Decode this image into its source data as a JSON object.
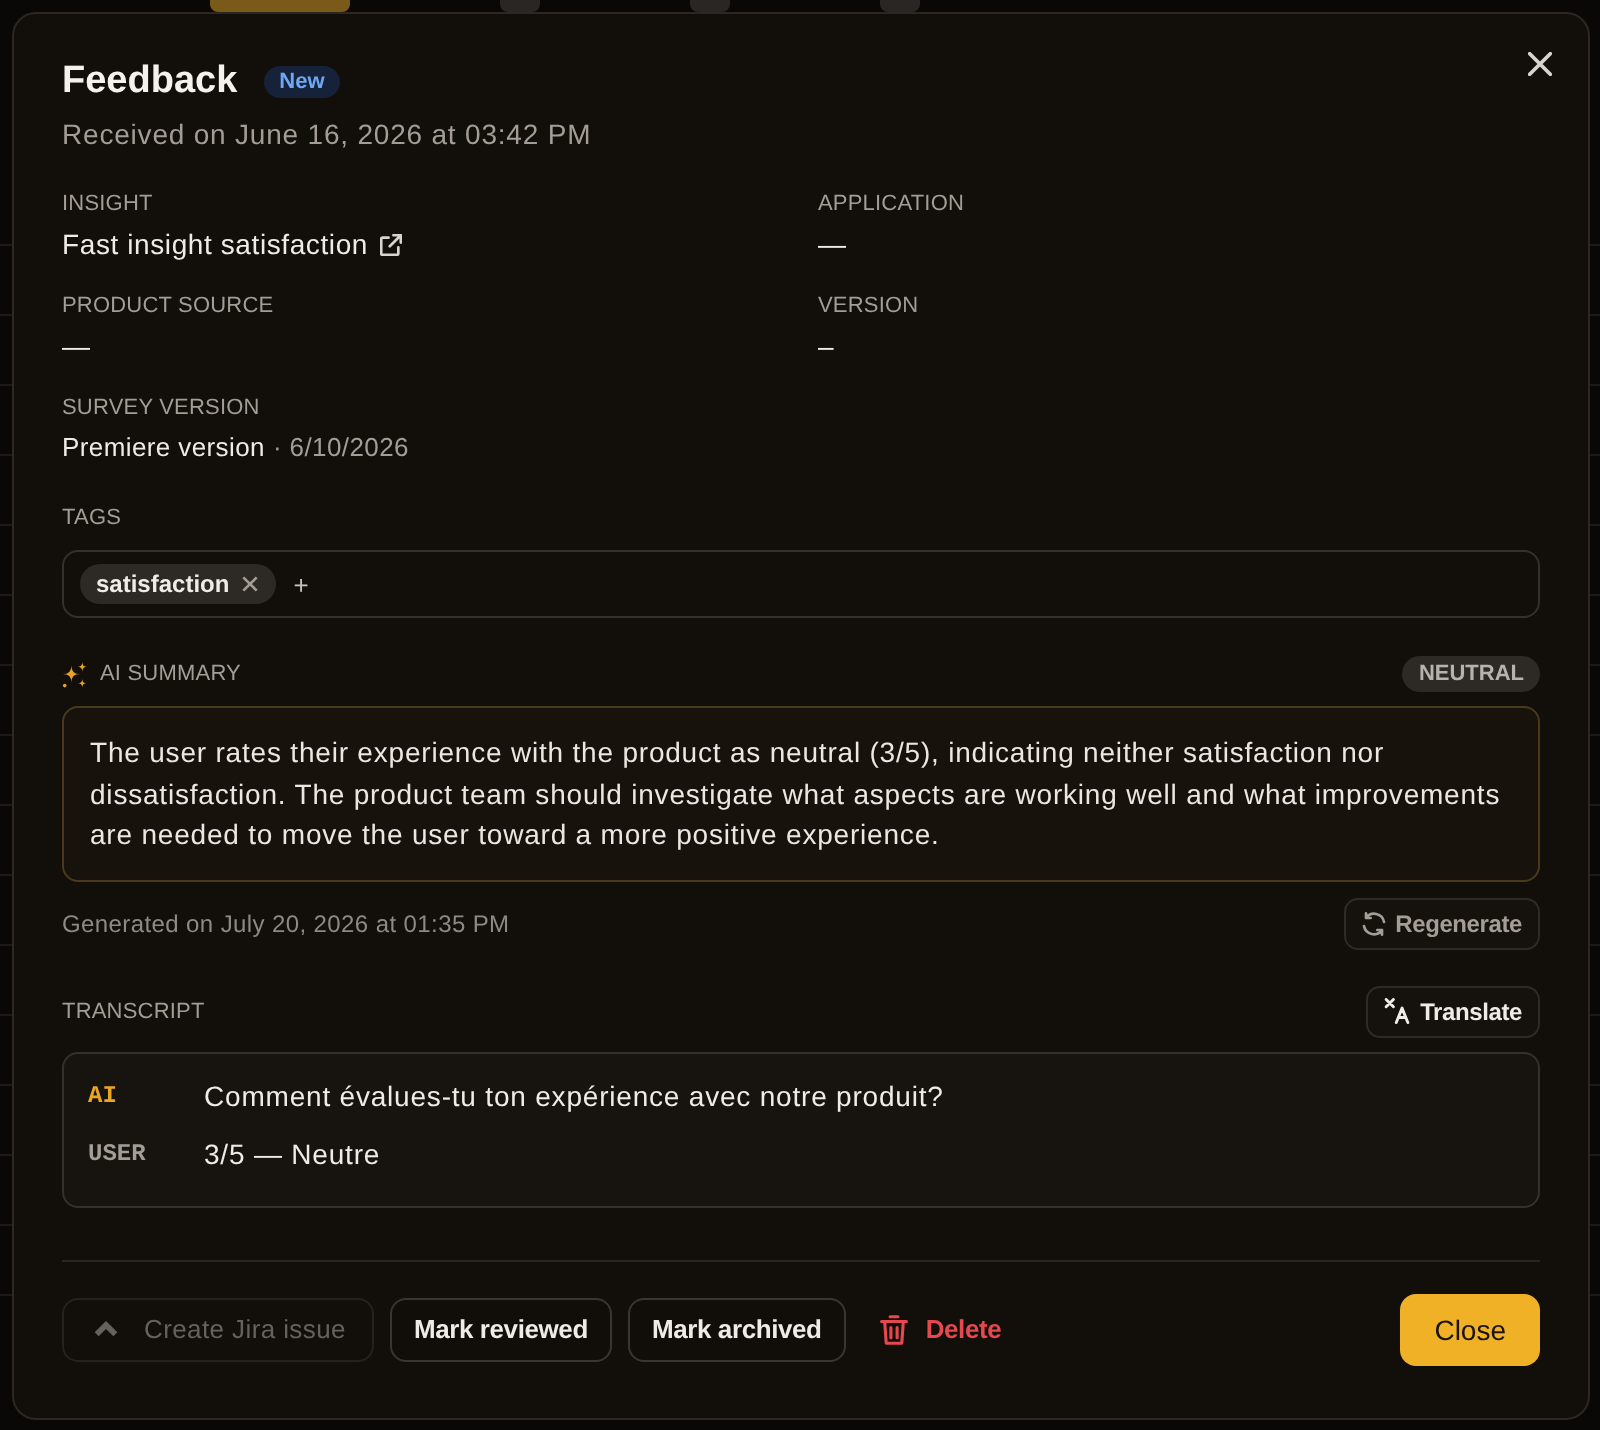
{
  "background": {
    "filters": [
      {
        "selected": true
      },
      {
        "selected": false
      },
      {
        "selected": false
      },
      {
        "selected": false
      }
    ]
  },
  "dialog": {
    "title": "Feedback",
    "badge": "New",
    "subtitle": "Received on June 16, 2026 at 03:42 PM",
    "fields": [
      {
        "label": "INSIGHT",
        "value": "Fast insight satisfaction",
        "kind": "link"
      },
      {
        "label": "APPLICATION",
        "value": "—",
        "kind": "text"
      },
      {
        "label": "PRODUCT SOURCE",
        "value": "—",
        "kind": "text"
      },
      {
        "label": "VERSION",
        "value": "–",
        "kind": "text"
      },
      {
        "label": "SURVEY VERSION",
        "value": "Premiere version",
        "detail": "· 6/10/2026",
        "kind": "dated"
      }
    ],
    "tags": {
      "label": "TAGS",
      "items": [
        "satisfaction"
      ],
      "add": "+"
    },
    "ai_summary": {
      "label": "AI SUMMARY",
      "sentiment": "NEUTRAL",
      "text": "The user rates their experience with the product as neutral (3/5), indicating neither satisfaction nor dissatisfaction. The product team should investigate what aspects are working well and what improvements are needed to move the user toward a more positive experience.",
      "generated": "Generated on July 20, 2026 at 01:35 PM",
      "regenerate": "Regenerate"
    },
    "transcript": {
      "label": "TRANSCRIPT",
      "translate": "Translate",
      "messages": [
        {
          "speaker": "AI",
          "kind": "ai",
          "text": "Comment évalues-tu ton expérience avec notre produit?"
        },
        {
          "speaker": "USER",
          "kind": "user",
          "text": "3/5 — Neutre"
        }
      ]
    },
    "actions": [
      {
        "label": "Create Jira issue",
        "kind": "jira",
        "disabled": true
      },
      {
        "label": "Mark reviewed",
        "kind": "outline",
        "disabled": false
      },
      {
        "label": "Mark archived",
        "kind": "outline",
        "disabled": false
      },
      {
        "label": "Delete",
        "kind": "danger",
        "disabled": false
      }
    ],
    "close": "Close"
  }
}
